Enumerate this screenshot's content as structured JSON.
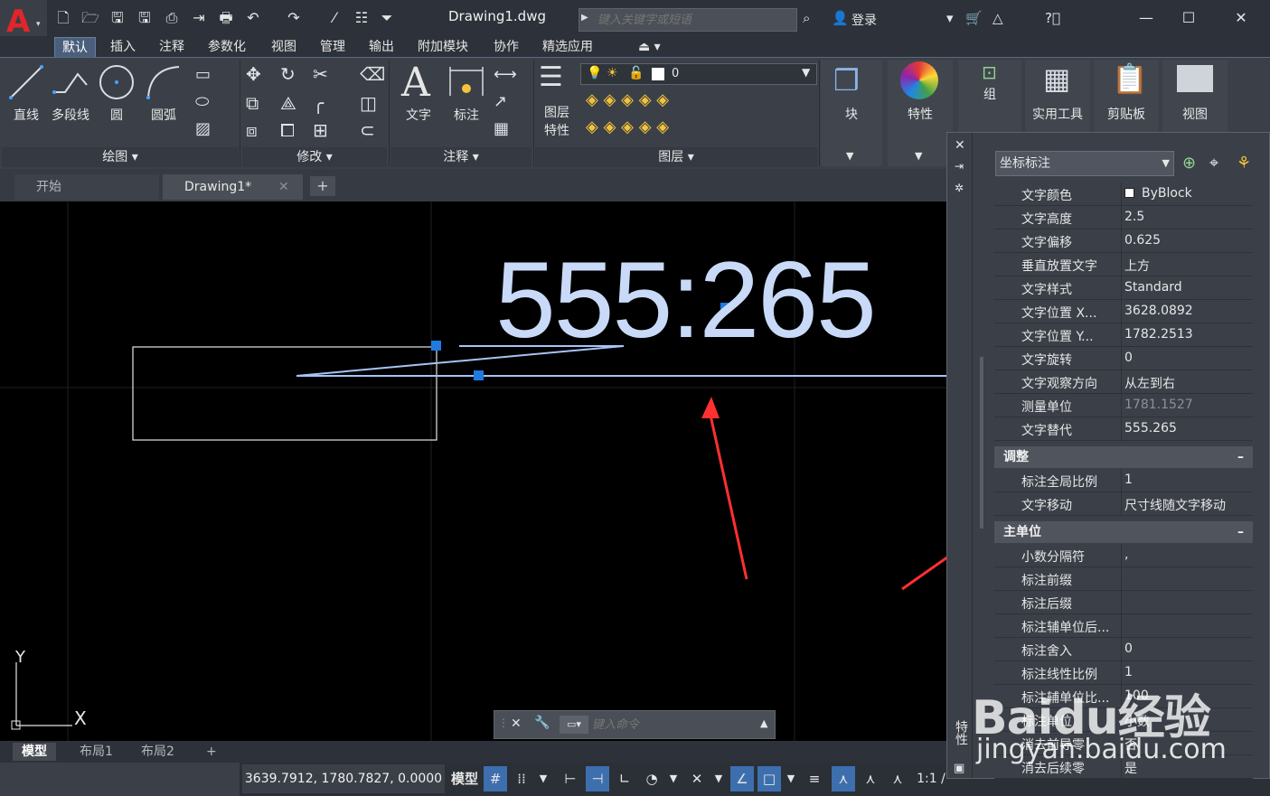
{
  "app": {
    "doc_title": "Drawing1.dwg"
  },
  "quick_access": {
    "search_placeholder": "键入关键字或短语",
    "login_label": "登录"
  },
  "ribbon_tabs": [
    "默认",
    "插入",
    "注释",
    "参数化",
    "视图",
    "管理",
    "输出",
    "附加模块",
    "协作",
    "精选应用"
  ],
  "ribbon": {
    "draw": {
      "line": "直线",
      "polyline": "多段线",
      "circle": "圆",
      "arc": "圆弧",
      "title": "绘图"
    },
    "modify": {
      "title": "修改"
    },
    "annotation": {
      "text": "文字",
      "dimension": "标注",
      "title": "注释"
    },
    "layers": {
      "properties_line1": "图层",
      "properties_line2": "特性",
      "current_layer": "0",
      "title": "图层"
    },
    "block": "块",
    "properties": "特性",
    "group": "组",
    "utilities": "实用工具",
    "clipboard": "剪贴板",
    "view": "视图"
  },
  "doc_tabs": {
    "start": "开始",
    "drawing": "Drawing1*"
  },
  "canvas": {
    "dim_text": "555:265",
    "ucs_x": "X",
    "ucs_y": "Y"
  },
  "command": {
    "placeholder": "键入命令"
  },
  "layout_tabs": [
    "模型",
    "布局1",
    "布局2"
  ],
  "status": {
    "coords": "3639.7912, 1780.7827, 0.0000",
    "model": "模型",
    "scale": "1:1 /"
  },
  "properties": {
    "object_type": "坐标标注",
    "rows_text": [
      {
        "name": "文字颜色",
        "value": "ByBlock"
      },
      {
        "name": "文字高度",
        "value": "2.5"
      },
      {
        "name": "文字偏移",
        "value": "0.625"
      },
      {
        "name": "垂直放置文字",
        "value": "上方"
      },
      {
        "name": "文字样式",
        "value": "Standard"
      },
      {
        "name": "文字位置 X...",
        "value": "3628.0892"
      },
      {
        "name": "文字位置 Y...",
        "value": "1782.2513"
      },
      {
        "name": "文字旋转",
        "value": "0"
      },
      {
        "name": "文字观察方向",
        "value": "从左到右"
      },
      {
        "name": "测量单位",
        "value": "1781.1527"
      },
      {
        "name": "文字替代",
        "value": "555.265"
      }
    ],
    "section_fit": "调整",
    "rows_fit": [
      {
        "name": "标注全局比例",
        "value": "1"
      },
      {
        "name": "文字移动",
        "value": "尺寸线随文字移动"
      }
    ],
    "section_primary": "主单位",
    "rows_primary": [
      {
        "name": "小数分隔符",
        "value": ","
      },
      {
        "name": "标注前缀",
        "value": ""
      },
      {
        "name": "标注后缀",
        "value": ""
      },
      {
        "name": "标注辅单位后...",
        "value": ""
      },
      {
        "name": "标注舍入",
        "value": "0"
      },
      {
        "name": "标注线性比例",
        "value": "1"
      },
      {
        "name": "标注辅单位比...",
        "value": "100"
      },
      {
        "name": "标注单位",
        "value": "小数"
      },
      {
        "name": "消去前导零",
        "value": "否"
      },
      {
        "name": "消去后续零",
        "value": "是"
      }
    ],
    "side_label": "特性"
  },
  "watermark": {
    "brand": "Baidu经验",
    "url": "jingyan.baidu.com"
  }
}
